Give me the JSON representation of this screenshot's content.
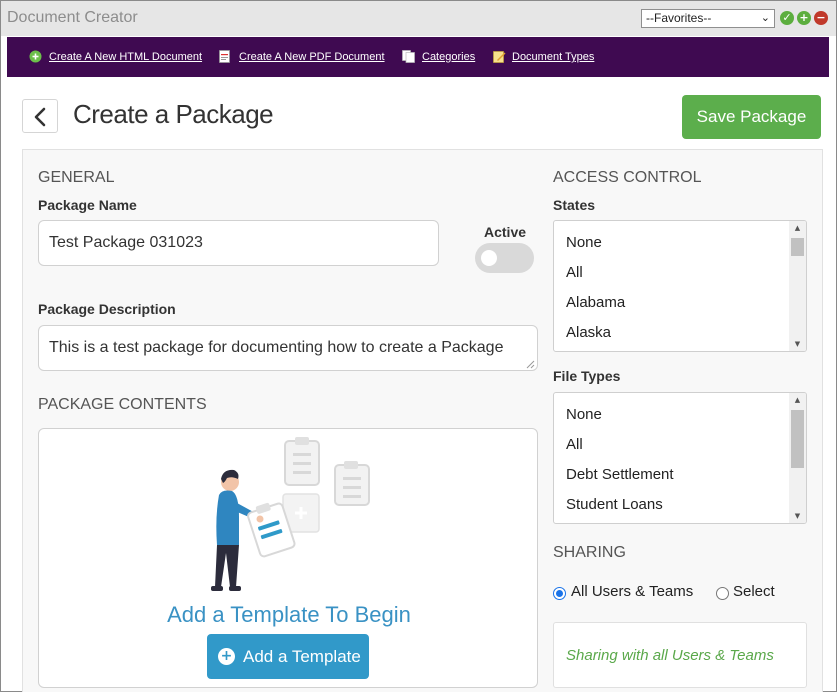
{
  "window": {
    "title": "Document Creator"
  },
  "favorites": {
    "selected": "--Favorites--"
  },
  "nav": {
    "items": [
      {
        "label": "Create A New HTML Document",
        "icon": "plus-circle-icon"
      },
      {
        "label": "Create A New PDF Document",
        "icon": "pdf-file-icon"
      },
      {
        "label": "Categories",
        "icon": "documents-icon"
      },
      {
        "label": "Document Types",
        "icon": "edit-note-icon"
      }
    ]
  },
  "header": {
    "title": "Create a Package",
    "save_label": "Save Package"
  },
  "general": {
    "heading": "GENERAL",
    "name_label": "Package Name",
    "name_value": "Test Package 031023",
    "active_label": "Active",
    "description_label": "Package Description",
    "description_value": "This is a test package for documenting how to create a Package"
  },
  "contents": {
    "heading": "PACKAGE CONTENTS",
    "hint": "Add a Template To Begin",
    "add_label": "Add a Template"
  },
  "access": {
    "heading": "ACCESS CONTROL",
    "states_label": "States",
    "states": [
      "None",
      "All",
      "Alabama",
      "Alaska"
    ],
    "filetypes_label": "File Types",
    "filetypes": [
      "None",
      "All",
      "Debt Settlement",
      "Student Loans"
    ]
  },
  "sharing": {
    "heading": "SHARING",
    "option_all": "All Users & Teams",
    "option_select": "Select",
    "status": "Sharing with all Users & Teams"
  },
  "colors": {
    "nav_bg": "#3f0a51",
    "save_green": "#5cae4c",
    "add_blue": "#3199c9",
    "share_green": "#5aa84a"
  }
}
